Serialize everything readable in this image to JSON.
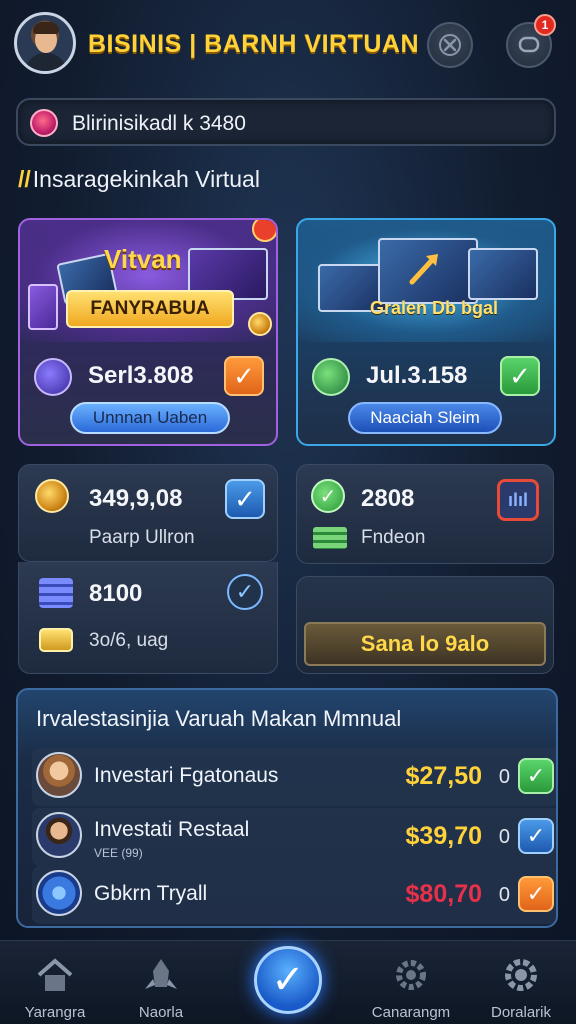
{
  "header": {
    "title": "BISINIS | BARNH VIRTUAN",
    "notification_count": "1"
  },
  "search": {
    "value": "Blirinisikadl k 3480"
  },
  "section_title": "Insaragekinkah Virtual",
  "cards": [
    {
      "art_title": "Vitvan",
      "art_banner": "FANYRABUA",
      "value": "Serl3.808",
      "button": "Unnnan Uaben",
      "check_color": "orange"
    },
    {
      "art_title": "",
      "art_banner": "Gralen Db bgal",
      "value": "Jul.3.158",
      "button": "Naaciah Sleim",
      "check_color": "green"
    }
  ],
  "stats_left": {
    "value1": "349,9,08",
    "label1": "Paarp Ullron",
    "value2": "8100",
    "label2": "3o/6, uag"
  },
  "stats_right": {
    "value1": "2808",
    "label1": "Fndeon",
    "button": "Sana Io 9alo"
  },
  "list": {
    "title": "Irvalestasinjia Varuah Makan Mmnual",
    "rows": [
      {
        "name": "Investari Fgatonaus",
        "sub": "",
        "amount": "$27,50",
        "zero": "0",
        "amount_color": "#ffd23a",
        "check": "green"
      },
      {
        "name": "Investati Restaal",
        "sub": "VEE (99)",
        "amount": "$39,70",
        "zero": "0",
        "amount_color": "#ffd23a",
        "check": "blue"
      },
      {
        "name": "Gbkrn Tryall",
        "sub": "",
        "amount": "$80,70",
        "zero": "0",
        "amount_color": "#e8304a",
        "check": "orange"
      }
    ]
  },
  "nav": {
    "items": [
      {
        "label": "Yarangra",
        "icon": "home-icon"
      },
      {
        "label": "Naorla",
        "icon": "rocket-icon"
      },
      {
        "label": "Canarangm",
        "icon": "gear-group-icon"
      },
      {
        "label": "Doralarik",
        "icon": "settings-icon"
      }
    ]
  }
}
